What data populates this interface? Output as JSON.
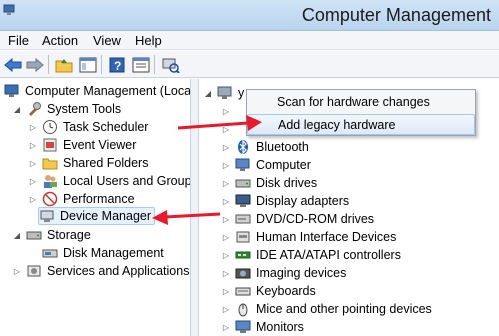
{
  "window": {
    "title": "Computer Management"
  },
  "menu": [
    "File",
    "Action",
    "View",
    "Help"
  ],
  "toolbar_icons": [
    "back-arrow-icon",
    "forward-arrow-icon",
    "up-folder-icon",
    "show-hide-tree-icon",
    "help-icon",
    "properties-icon",
    "scan-hardware-icon"
  ],
  "left_tree": {
    "root": "Computer Management (Local",
    "system_tools": "System Tools",
    "task_scheduler": "Task Scheduler",
    "event_viewer": "Event Viewer",
    "shared_folders": "Shared Folders",
    "local_users": "Local Users and Groups",
    "performance": "Performance",
    "device_manager": "Device Manager",
    "storage": "Storage",
    "disk_management": "Disk Management",
    "services": "Services and Applications"
  },
  "right_tree": {
    "computer_node": "y",
    "devices": [
      "Bluetooth",
      "Computer",
      "Disk drives",
      "Display adapters",
      "DVD/CD-ROM drives",
      "Human Interface Devices",
      "IDE ATA/ATAPI controllers",
      "Imaging devices",
      "Keyboards",
      "Mice and other pointing devices",
      "Monitors"
    ]
  },
  "context_menu": {
    "scan": "Scan for hardware changes",
    "add_legacy": "Add legacy hardware"
  },
  "colors": {
    "annotation_arrow": "#e8192c",
    "selection": "#e5f0fb",
    "titlebar": "#cfe3f5"
  }
}
